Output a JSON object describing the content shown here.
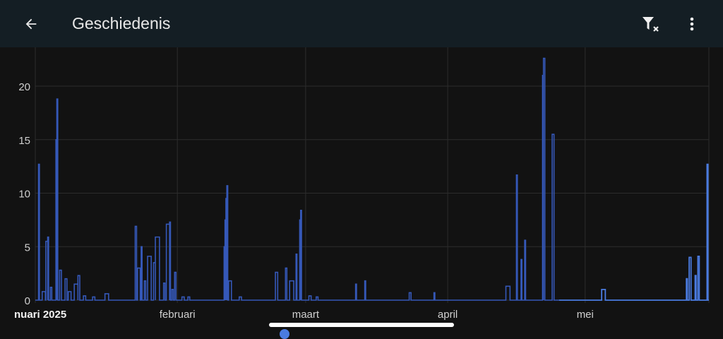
{
  "appbar": {
    "title": "Geschiedenis",
    "back_icon": "arrow-left-icon",
    "filter_icon": "filter-clear-icon",
    "more_icon": "more-vert-icon"
  },
  "colors": {
    "line": "#3558b8",
    "line_recent": "#4a7be0",
    "grid": "#2c2c2c",
    "axis_text": "#d0d0d0"
  },
  "chart_data": {
    "type": "line",
    "step": true,
    "title": "",
    "xlabel": "",
    "ylabel": "",
    "ylim": [
      0,
      23.5
    ],
    "xlim_days_since_jan1": [
      0,
      147
    ],
    "y_ticks": [
      "0",
      "5",
      "10",
      "15",
      "20"
    ],
    "y_tick_values": [
      0,
      5,
      10,
      15,
      20
    ],
    "x_ticks": [
      {
        "label": "nuari 2025",
        "day": 0
      },
      {
        "label": "februari",
        "day": 31
      },
      {
        "label": "maart",
        "day": 59
      },
      {
        "label": "april",
        "day": 90
      },
      {
        "label": "mei",
        "day": 120
      }
    ],
    "grid": true,
    "series_note": "spikes as [start_day, end_day, value] over a zero baseline",
    "spikes": [
      [
        0.7,
        0.9,
        12.7
      ],
      [
        1.5,
        2.2,
        0.8
      ],
      [
        2.3,
        2.7,
        5.5
      ],
      [
        2.7,
        2.9,
        5.9
      ],
      [
        3.3,
        3.6,
        1.2
      ],
      [
        4.5,
        4.7,
        15
      ],
      [
        4.7,
        4.9,
        18.8
      ],
      [
        5.3,
        5.7,
        2.8
      ],
      [
        6.5,
        6.9,
        2.0
      ],
      [
        7.2,
        7.8,
        0.8
      ],
      [
        8.5,
        9.3,
        1.5
      ],
      [
        9.3,
        9.7,
        2.3
      ],
      [
        10.5,
        11,
        0.4
      ],
      [
        12.5,
        13,
        0.3
      ],
      [
        15.2,
        16,
        0.6
      ],
      [
        21.8,
        22.1,
        6.9
      ],
      [
        22.3,
        22.9,
        3.0
      ],
      [
        23.1,
        23.3,
        5.0
      ],
      [
        23.8,
        24.1,
        1.8
      ],
      [
        24.5,
        25.3,
        4.1
      ],
      [
        25.8,
        26.2,
        3.5
      ],
      [
        26.2,
        27.1,
        5.9
      ],
      [
        28,
        28.3,
        1.6
      ],
      [
        28.6,
        29.3,
        7.1
      ],
      [
        29.3,
        29.5,
        7.3
      ],
      [
        29.8,
        30.1,
        1.0
      ],
      [
        30.4,
        30.7,
        2.6
      ],
      [
        32,
        32.5,
        0.3
      ],
      [
        33.3,
        33.7,
        0.3
      ],
      [
        41.2,
        41.4,
        5.0
      ],
      [
        41.4,
        41.6,
        7.5
      ],
      [
        41.6,
        41.8,
        9.5
      ],
      [
        41.8,
        42.0,
        10.7
      ],
      [
        42.2,
        42.8,
        1.8
      ],
      [
        44.5,
        45,
        0.3
      ],
      [
        52.4,
        52.9,
        2.6
      ],
      [
        54.6,
        54.9,
        3.0
      ],
      [
        55.5,
        56.4,
        1.8
      ],
      [
        56.9,
        57.1,
        4.3
      ],
      [
        57.7,
        57.9,
        7.5
      ],
      [
        57.9,
        58.1,
        8.4
      ],
      [
        59.7,
        60.2,
        0.4
      ],
      [
        61.3,
        61.7,
        0.3
      ],
      [
        69.9,
        70.1,
        1.5
      ],
      [
        71.9,
        72.1,
        1.8
      ],
      [
        81.6,
        82,
        0.7
      ],
      [
        87,
        87.2,
        0.7
      ],
      [
        102.7,
        103.6,
        1.3
      ],
      [
        105,
        105.2,
        11.7
      ],
      [
        106,
        106.2,
        3.8
      ],
      [
        106.8,
        107,
        5.6
      ],
      [
        110.7,
        110.9,
        21.0
      ],
      [
        110.9,
        111.2,
        22.6
      ],
      [
        112.8,
        113.2,
        15.5
      ]
    ],
    "spikes_recent": [
      [
        123.6,
        124.4,
        1.0
      ],
      [
        142.1,
        142.3,
        2.0
      ],
      [
        142.7,
        143.1,
        4.0
      ],
      [
        144,
        144.2,
        2.3
      ],
      [
        144.6,
        144.9,
        4.1
      ],
      [
        146.6,
        146.8,
        12.7
      ]
    ],
    "recent_start_day": 114.3
  }
}
